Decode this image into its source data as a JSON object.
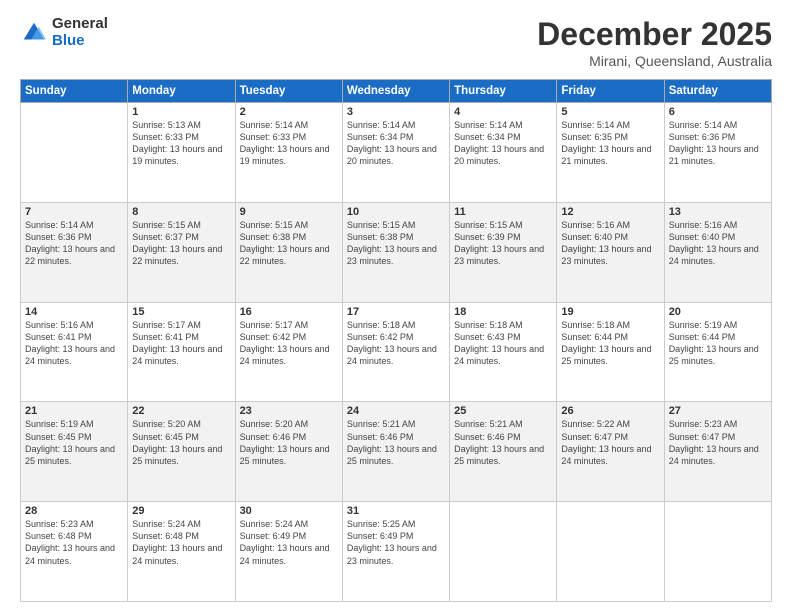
{
  "logo": {
    "general": "General",
    "blue": "Blue"
  },
  "header": {
    "month": "December 2025",
    "location": "Mirani, Queensland, Australia"
  },
  "days_of_week": [
    "Sunday",
    "Monday",
    "Tuesday",
    "Wednesday",
    "Thursday",
    "Friday",
    "Saturday"
  ],
  "weeks": [
    [
      {
        "day": "",
        "info": ""
      },
      {
        "day": "1",
        "info": "Sunrise: 5:13 AM\nSunset: 6:33 PM\nDaylight: 13 hours\nand 19 minutes."
      },
      {
        "day": "2",
        "info": "Sunrise: 5:14 AM\nSunset: 6:33 PM\nDaylight: 13 hours\nand 19 minutes."
      },
      {
        "day": "3",
        "info": "Sunrise: 5:14 AM\nSunset: 6:34 PM\nDaylight: 13 hours\nand 20 minutes."
      },
      {
        "day": "4",
        "info": "Sunrise: 5:14 AM\nSunset: 6:34 PM\nDaylight: 13 hours\nand 20 minutes."
      },
      {
        "day": "5",
        "info": "Sunrise: 5:14 AM\nSunset: 6:35 PM\nDaylight: 13 hours\nand 21 minutes."
      },
      {
        "day": "6",
        "info": "Sunrise: 5:14 AM\nSunset: 6:36 PM\nDaylight: 13 hours\nand 21 minutes."
      }
    ],
    [
      {
        "day": "7",
        "info": "Sunrise: 5:14 AM\nSunset: 6:36 PM\nDaylight: 13 hours\nand 22 minutes."
      },
      {
        "day": "8",
        "info": "Sunrise: 5:15 AM\nSunset: 6:37 PM\nDaylight: 13 hours\nand 22 minutes."
      },
      {
        "day": "9",
        "info": "Sunrise: 5:15 AM\nSunset: 6:38 PM\nDaylight: 13 hours\nand 22 minutes."
      },
      {
        "day": "10",
        "info": "Sunrise: 5:15 AM\nSunset: 6:38 PM\nDaylight: 13 hours\nand 23 minutes."
      },
      {
        "day": "11",
        "info": "Sunrise: 5:15 AM\nSunset: 6:39 PM\nDaylight: 13 hours\nand 23 minutes."
      },
      {
        "day": "12",
        "info": "Sunrise: 5:16 AM\nSunset: 6:40 PM\nDaylight: 13 hours\nand 23 minutes."
      },
      {
        "day": "13",
        "info": "Sunrise: 5:16 AM\nSunset: 6:40 PM\nDaylight: 13 hours\nand 24 minutes."
      }
    ],
    [
      {
        "day": "14",
        "info": "Sunrise: 5:16 AM\nSunset: 6:41 PM\nDaylight: 13 hours\nand 24 minutes."
      },
      {
        "day": "15",
        "info": "Sunrise: 5:17 AM\nSunset: 6:41 PM\nDaylight: 13 hours\nand 24 minutes."
      },
      {
        "day": "16",
        "info": "Sunrise: 5:17 AM\nSunset: 6:42 PM\nDaylight: 13 hours\nand 24 minutes."
      },
      {
        "day": "17",
        "info": "Sunrise: 5:18 AM\nSunset: 6:42 PM\nDaylight: 13 hours\nand 24 minutes."
      },
      {
        "day": "18",
        "info": "Sunrise: 5:18 AM\nSunset: 6:43 PM\nDaylight: 13 hours\nand 24 minutes."
      },
      {
        "day": "19",
        "info": "Sunrise: 5:18 AM\nSunset: 6:44 PM\nDaylight: 13 hours\nand 25 minutes."
      },
      {
        "day": "20",
        "info": "Sunrise: 5:19 AM\nSunset: 6:44 PM\nDaylight: 13 hours\nand 25 minutes."
      }
    ],
    [
      {
        "day": "21",
        "info": "Sunrise: 5:19 AM\nSunset: 6:45 PM\nDaylight: 13 hours\nand 25 minutes."
      },
      {
        "day": "22",
        "info": "Sunrise: 5:20 AM\nSunset: 6:45 PM\nDaylight: 13 hours\nand 25 minutes."
      },
      {
        "day": "23",
        "info": "Sunrise: 5:20 AM\nSunset: 6:46 PM\nDaylight: 13 hours\nand 25 minutes."
      },
      {
        "day": "24",
        "info": "Sunrise: 5:21 AM\nSunset: 6:46 PM\nDaylight: 13 hours\nand 25 minutes."
      },
      {
        "day": "25",
        "info": "Sunrise: 5:21 AM\nSunset: 6:46 PM\nDaylight: 13 hours\nand 25 minutes."
      },
      {
        "day": "26",
        "info": "Sunrise: 5:22 AM\nSunset: 6:47 PM\nDaylight: 13 hours\nand 24 minutes."
      },
      {
        "day": "27",
        "info": "Sunrise: 5:23 AM\nSunset: 6:47 PM\nDaylight: 13 hours\nand 24 minutes."
      }
    ],
    [
      {
        "day": "28",
        "info": "Sunrise: 5:23 AM\nSunset: 6:48 PM\nDaylight: 13 hours\nand 24 minutes."
      },
      {
        "day": "29",
        "info": "Sunrise: 5:24 AM\nSunset: 6:48 PM\nDaylight: 13 hours\nand 24 minutes."
      },
      {
        "day": "30",
        "info": "Sunrise: 5:24 AM\nSunset: 6:49 PM\nDaylight: 13 hours\nand 24 minutes."
      },
      {
        "day": "31",
        "info": "Sunrise: 5:25 AM\nSunset: 6:49 PM\nDaylight: 13 hours\nand 23 minutes."
      },
      {
        "day": "",
        "info": ""
      },
      {
        "day": "",
        "info": ""
      },
      {
        "day": "",
        "info": ""
      }
    ]
  ]
}
